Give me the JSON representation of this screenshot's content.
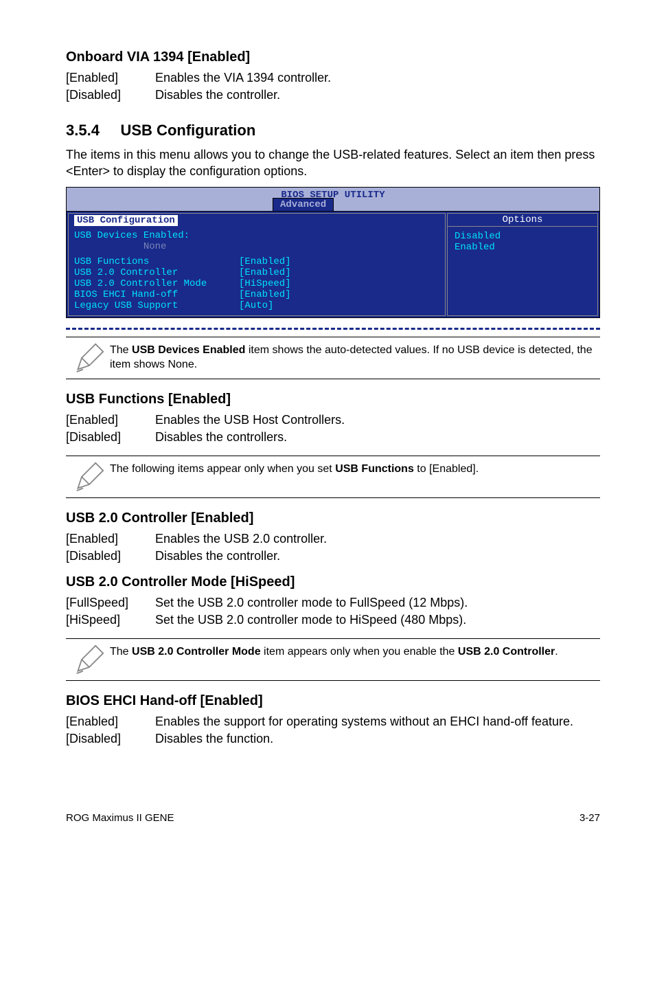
{
  "s1": {
    "title": "Onboard VIA 1394 [Enabled]",
    "rows": [
      {
        "k": "[Enabled]",
        "v": "Enables the VIA 1394 controller."
      },
      {
        "k": "[Disabled]",
        "v": "Disables the controller."
      }
    ]
  },
  "section": {
    "num": "3.5.4",
    "name": "USB Configuration",
    "intro": "The items in this menu allows you to change the USB-related features. Select an item then press <Enter> to display the configuration options."
  },
  "bios": {
    "title": "BIOS SETUP UTILITY",
    "tab": "Advanced",
    "left_head": "USB Configuration",
    "devices_label": "USB Devices Enabled:",
    "devices_value": "None",
    "rows": [
      {
        "k": "USB Functions",
        "v": "[Enabled]"
      },
      {
        "k": "USB 2.0 Controller",
        "v": "[Enabled]"
      },
      {
        "k": "USB 2.0 Controller Mode",
        "v": "[HiSpeed]"
      },
      {
        "k": "BIOS EHCI Hand-off",
        "v": "[Enabled]"
      },
      {
        "k": "Legacy USB Support",
        "v": "[Auto]"
      }
    ],
    "options_head": "Options",
    "options": [
      "Disabled",
      "Enabled"
    ]
  },
  "note1": {
    "text_pre": "The ",
    "b": "USB Devices Enabled",
    "text_post": " item shows the auto-detected values. If no USB device is detected, the item shows None."
  },
  "s2": {
    "title": "USB Functions [Enabled]",
    "rows": [
      {
        "k": "[Enabled]",
        "v": "Enables the USB Host Controllers."
      },
      {
        "k": "[Disabled]",
        "v": "Disables the controllers."
      }
    ]
  },
  "note2": {
    "text_pre": "The following items appear only when you set ",
    "b": "USB Functions",
    "text_post": " to [Enabled]."
  },
  "s3": {
    "title": "USB 2.0 Controller [Enabled]",
    "rows": [
      {
        "k": "[Enabled]",
        "v": "Enables the USB 2.0 controller."
      },
      {
        "k": "[Disabled]",
        "v": "Disables the controller."
      }
    ]
  },
  "s4": {
    "title": "USB 2.0 Controller Mode [HiSpeed]",
    "rows": [
      {
        "k": "[FullSpeed]",
        "v": "Set the USB 2.0 controller mode to FullSpeed (12 Mbps)."
      },
      {
        "k": "[HiSpeed]",
        "v": "Set the USB 2.0 controller mode to HiSpeed (480 Mbps)."
      }
    ]
  },
  "note3": {
    "text_pre": "The ",
    "b": "USB 2.0 Controller Mode",
    "text_mid": " item appears only when you enable the ",
    "b2": "USB 2.0 Controller",
    "text_post": "."
  },
  "s5": {
    "title": "BIOS EHCI Hand-off [Enabled]",
    "rows": [
      {
        "k": "[Enabled]",
        "v": "Enables the support for operating systems without an EHCI hand-off feature."
      },
      {
        "k": "[Disabled]",
        "v": "Disables the function."
      }
    ]
  },
  "footer": {
    "left": "ROG Maximus II GENE",
    "right": "3-27"
  }
}
